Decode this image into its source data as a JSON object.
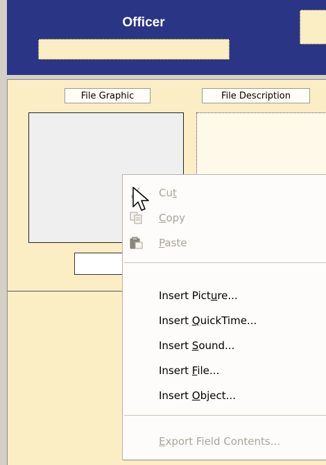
{
  "header": {
    "title": "Officer",
    "colors": {
      "band": "#2a3585",
      "field": "#fbedc4"
    }
  },
  "form": {
    "file_graphic_label": "File Graphic",
    "file_description_label": "File Description",
    "background": "#fbedc4"
  },
  "context_menu": {
    "items": [
      {
        "label": "Cut",
        "mnemonic": "t",
        "icon": "scissors-icon",
        "enabled": false
      },
      {
        "label": "Copy",
        "mnemonic": "C",
        "icon": "copy-icon",
        "enabled": false
      },
      {
        "label": "Paste",
        "mnemonic": "P",
        "icon": "paste-icon",
        "enabled": false
      },
      {
        "label": "Insert Picture...",
        "mnemonic": "u",
        "enabled": true
      },
      {
        "label": "Insert QuickTime...",
        "mnemonic": "Q",
        "enabled": true
      },
      {
        "label": "Insert Sound...",
        "mnemonic": "S",
        "enabled": true
      },
      {
        "label": "Insert File...",
        "mnemonic": "F",
        "enabled": true
      },
      {
        "label": "Insert Object...",
        "mnemonic": "O",
        "enabled": true
      },
      {
        "label": "Export Field Contents...",
        "mnemonic": "E",
        "enabled": false
      }
    ]
  }
}
